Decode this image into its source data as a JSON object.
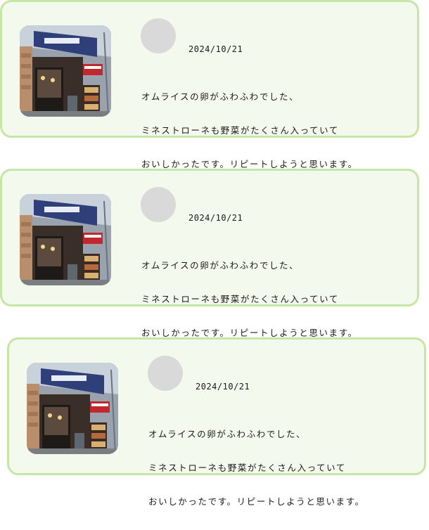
{
  "reviews": [
    {
      "date": "2024/10/21",
      "comment": [
        "オムライスの卵がふわふわでした、",
        "ミネストローネも野菜がたくさん入っていて",
        "おいしかったです。リピートしようと思います。"
      ]
    },
    {
      "date": "2024/10/21",
      "comment": [
        "オムライスの卵がふわふわでした、",
        "ミネストローネも野菜がたくさん入っていて",
        "おいしかったです。リピートしようと思います。"
      ]
    },
    {
      "date": "2024/10/21",
      "comment": [
        "オムライスの卵がふわふわでした、",
        "ミネストローネも野菜がたくさん入っていて",
        "おいしかったです。リピートしようと思います。"
      ]
    }
  ],
  "colors": {
    "card_background": "#f3f9ec",
    "card_border": "#c6e6a4",
    "avatar_placeholder": "#d9d9d9",
    "text": "#1b1b1b"
  }
}
